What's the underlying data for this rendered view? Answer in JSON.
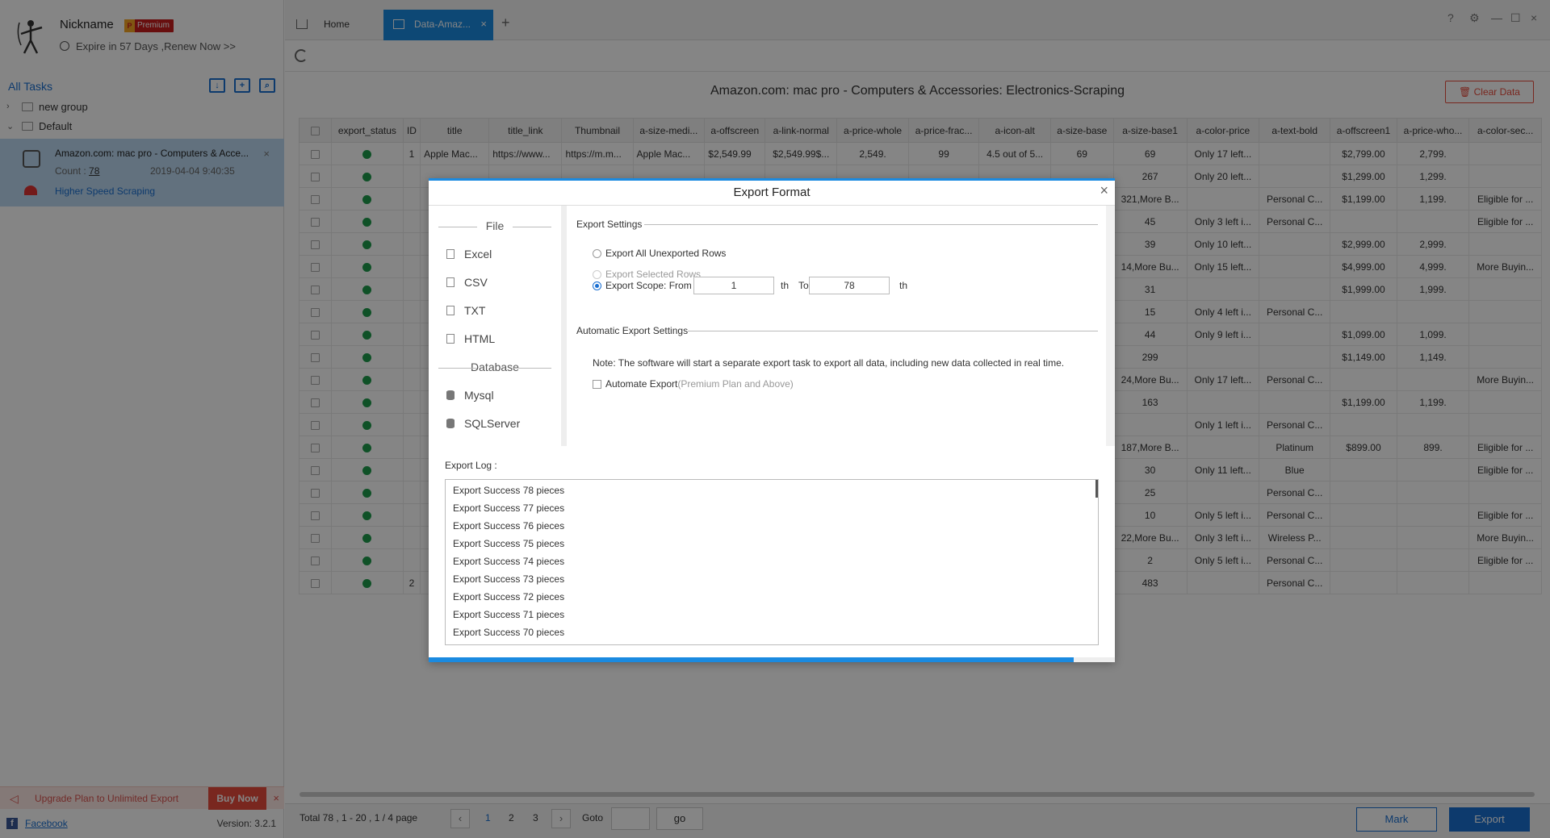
{
  "sidebar": {
    "nickname": "Nickname",
    "badge": "Premium",
    "badge_crown": "P",
    "expire_text": "Expire in 57 Days ,Renew Now >>",
    "all_tasks": "All Tasks",
    "tree": [
      {
        "label": "new group",
        "arrow": "›"
      },
      {
        "label": "Default",
        "arrow": "⌄"
      }
    ],
    "task": {
      "title": "Amazon.com: mac pro - Computers & Acce...",
      "count_label": "Count :",
      "count_value": "78",
      "date": "2019-04-04 9:40:35",
      "speed": "Higher Speed Scraping"
    },
    "upgrade_text": "Upgrade Plan to Unlimited Export",
    "buy_now": "Buy Now",
    "facebook": "Facebook",
    "version": "Version: 3.2.1"
  },
  "tabs": {
    "home": "Home",
    "active": "Data-Amaz...",
    "plus": "+"
  },
  "main": {
    "title": "Amazon.com: mac pro - Computers & Accessories: Electronics-Scraping",
    "clear_data": "Clear Data"
  },
  "table": {
    "columns": [
      "export_status",
      "ID",
      "title",
      "title_link",
      "Thumbnail",
      "a-size-medi...",
      "a-offscreen",
      "a-link-normal",
      "a-price-whole",
      "a-price-frac...",
      "a-icon-alt",
      "a-size-base",
      "a-size-base1",
      "a-color-price",
      "a-text-bold",
      "a-offscreen1",
      "a-price-who...",
      "a-color-sec..."
    ],
    "rows": [
      [
        "1",
        "Apple Mac...",
        "https://www...",
        "https://m.m...",
        "Apple Mac...",
        "$2,549.99",
        "$2,549.99$...",
        "2,549.",
        "99",
        "4.5 out of 5...",
        "69",
        "69",
        "Only 17 left...",
        "",
        "$2,799.00",
        "2,799.",
        ""
      ],
      [
        "",
        "",
        "",
        "",
        "",
        "",
        "",
        "",
        "",
        "",
        "",
        "267",
        "Only 20 left...",
        "",
        "$1,299.00",
        "1,299.",
        ""
      ],
      [
        "",
        "",
        "",
        "",
        "",
        "",
        "",
        "",
        "",
        "",
        "",
        "321,More B...",
        "",
        "Personal C...",
        "$1,199.00",
        "1,199.",
        "Eligible for ..."
      ],
      [
        "",
        "",
        "",
        "",
        "",
        "",
        "",
        "",
        "",
        "",
        "",
        "45",
        "Only 3 left i...",
        "Personal C...",
        "",
        "",
        "Eligible for ..."
      ],
      [
        "",
        "",
        "",
        "",
        "",
        "",
        "",
        "",
        "",
        "",
        "",
        "39",
        "Only 10 left...",
        "",
        "$2,999.00",
        "2,999.",
        ""
      ],
      [
        "",
        "",
        "",
        "",
        "",
        "",
        "",
        "",
        "",
        "",
        "",
        "14,More Bu...",
        "Only 15 left...",
        "",
        "$4,999.00",
        "4,999.",
        "More Buyin..."
      ],
      [
        "",
        "",
        "",
        "",
        "",
        "",
        "",
        "",
        "",
        "",
        "",
        "31",
        "",
        "",
        "$1,999.00",
        "1,999.",
        ""
      ],
      [
        "",
        "",
        "",
        "",
        "",
        "",
        "",
        "",
        "",
        "",
        "",
        "15",
        "Only 4 left i...",
        "Personal C...",
        "",
        "",
        ""
      ],
      [
        "",
        "",
        "",
        "",
        "",
        "",
        "",
        "",
        "",
        "",
        "",
        "44",
        "Only 9 left i...",
        "",
        "$1,099.00",
        "1,099.",
        ""
      ],
      [
        "",
        "",
        "",
        "",
        "",
        "",
        "",
        "",
        "",
        "",
        "",
        "299",
        "",
        "",
        "$1,149.00",
        "1,149.",
        ""
      ],
      [
        "",
        "",
        "",
        "",
        "",
        "",
        "",
        "",
        "",
        "",
        "",
        "24,More Bu...",
        "Only 17 left...",
        "Personal C...",
        "",
        "",
        "More Buyin..."
      ],
      [
        "",
        "",
        "",
        "",
        "",
        "",
        "",
        "",
        "",
        "",
        "",
        "163",
        "",
        "",
        "$1,199.00",
        "1,199.",
        ""
      ],
      [
        "",
        "",
        "",
        "",
        "",
        "",
        "",
        "",
        "",
        "",
        "",
        "",
        "Only 1 left i...",
        "Personal C...",
        "",
        "",
        ""
      ],
      [
        "",
        "",
        "",
        "",
        "",
        "",
        "",
        "",
        "",
        "",
        "",
        "187,More B...",
        "",
        "Platinum",
        "$899.00",
        "899.",
        "Eligible for ..."
      ],
      [
        "",
        "",
        "",
        "",
        "",
        "",
        "",
        "",
        "",
        "",
        "",
        "30",
        "Only 11 left...",
        "Blue",
        "",
        "",
        "Eligible for ..."
      ],
      [
        "",
        "",
        "",
        "",
        "",
        "",
        "",
        "",
        "",
        "",
        "",
        "25",
        "",
        "Personal C...",
        "",
        "",
        ""
      ],
      [
        "",
        "",
        "",
        "",
        "",
        "",
        "",
        "",
        "",
        "",
        "",
        "10",
        "Only 5 left i...",
        "Personal C...",
        "",
        "",
        "Eligible for ..."
      ],
      [
        "",
        "",
        "",
        "",
        "",
        "",
        "",
        "",
        "",
        "",
        "",
        "22,More Bu...",
        "Only 3 left i...",
        "Wireless P...",
        "",
        "",
        "More Buyin..."
      ],
      [
        "",
        "",
        "",
        "",
        "",
        "",
        "",
        "",
        "",
        "",
        "",
        "2",
        "Only 5 left i...",
        "Personal C...",
        "",
        "",
        "Eligible for ..."
      ],
      [
        "2",
        "",
        "",
        "",
        "",
        "",
        "",
        "",
        "",
        "",
        "",
        "483",
        "",
        "Personal C...",
        "",
        "",
        ""
      ]
    ]
  },
  "pager": {
    "total": "Total  78  ,  1  - 20 ,  1  /  4  page",
    "prev": "‹",
    "next": "›",
    "pages": [
      "1",
      "2",
      "3"
    ],
    "goto": "Goto",
    "go": "go"
  },
  "buttons": {
    "mark": "Mark",
    "export": "Export"
  },
  "modal": {
    "title": "Export Format",
    "close": "×",
    "file_head": "File",
    "file_options": [
      "Excel",
      "CSV",
      "TXT",
      "HTML"
    ],
    "db_head": "Database",
    "db_options": [
      "Mysql",
      "SQLServer"
    ],
    "export_settings": "Export Settings",
    "opt_all": "Export All Unexported Rows",
    "opt_selected": "Export Selected Rows",
    "opt_scope": "Export Scope: From",
    "scope_from": "1",
    "scope_th1": "th",
    "scope_to_label": "To",
    "scope_to": "78",
    "scope_th2": "th",
    "auto_settings": "Automatic Export Settings",
    "note": "Note: The software will start a separate export task to export all data, including new data collected in real time.",
    "auto_export": "Automate Export",
    "auto_note": "(Premium Plan and Above)",
    "log_label": "Export Log :",
    "log": [
      "Export Success  78 pieces",
      "Export Success  77 pieces",
      "Export Success  76 pieces",
      "Export Success  75 pieces",
      "Export Success  74 pieces",
      "Export Success  73 pieces",
      "Export Success  72 pieces",
      "Export Success  71 pieces",
      "Export Success  70 pieces"
    ],
    "progress": 0.94
  },
  "colors": {
    "accent": "#1a8ae0",
    "danger": "#e84c3d",
    "success": "#1e9b4b"
  }
}
